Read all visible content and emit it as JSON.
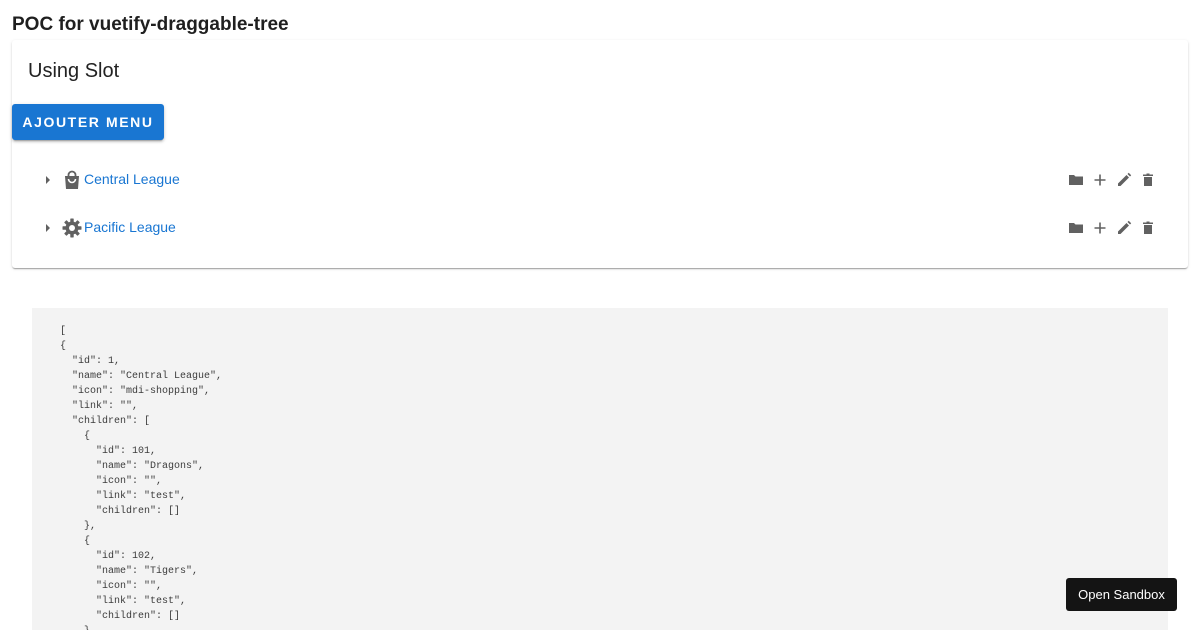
{
  "page": {
    "title": "POC for vuetify-draggable-tree"
  },
  "card": {
    "title": "Using Slot",
    "add_button_label": "Ajouter menu",
    "tree_items": [
      {
        "label": "Central League",
        "icon": "shopping-bag-icon"
      },
      {
        "label": "Pacific League",
        "icon": "gear-icon"
      }
    ],
    "row_action_icons": [
      "folder-icon",
      "plus-icon",
      "pencil-icon",
      "trash-icon"
    ]
  },
  "code_block": {
    "text": "[\n{\n  \"id\": 1,\n  \"name\": \"Central League\",\n  \"icon\": \"mdi-shopping\",\n  \"link\": \"\",\n  \"children\": [\n    {\n      \"id\": 101,\n      \"name\": \"Dragons\",\n      \"icon\": \"\",\n      \"link\": \"test\",\n      \"children\": []\n    },\n    {\n      \"id\": 102,\n      \"name\": \"Tigers\",\n      \"icon\": \"\",\n      \"link\": \"test\",\n      \"children\": []\n    }"
  },
  "sandbox_button_label": "Open Sandbox",
  "colors": {
    "primary": "#1976d2",
    "icon_gray": "#616161",
    "code_background": "#f3f3f3",
    "sandbox_button": "#141414"
  }
}
